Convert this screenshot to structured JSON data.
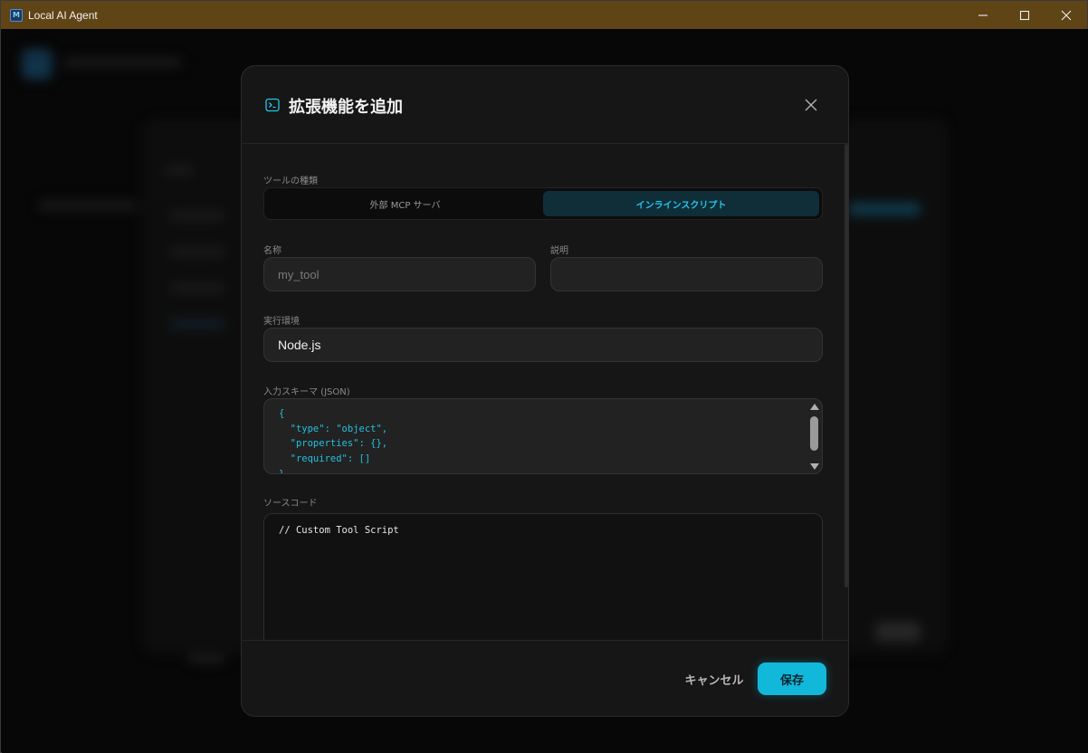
{
  "window": {
    "title": "Local AI Agent",
    "icon_letter": "M",
    "controls": [
      "minimize-icon",
      "maximize-icon",
      "close-icon"
    ]
  },
  "modal": {
    "title": "拡張機能を追加",
    "header_icon": "terminal-icon",
    "tool_type": {
      "label": "ツールの種類",
      "options": [
        "外部 MCP サーバ",
        "インラインスクリプト"
      ],
      "selected": "インラインスクリプト"
    },
    "name": {
      "label": "名称",
      "placeholder": "my_tool"
    },
    "description": {
      "label": "説明",
      "value": ""
    },
    "runtime": {
      "label": "実行環境",
      "value": "Node.js"
    },
    "input_schema": {
      "label": "入力スキーマ (JSON)",
      "code": "{\n  \"type\": \"object\",\n  \"properties\": {},\n  \"required\": []\n}"
    },
    "source_code": {
      "label": "ソースコード",
      "code": "// Custom Tool Script"
    },
    "footer": {
      "cancel_label": "キャンセル",
      "save_label": "保存"
    }
  },
  "colors": {
    "titlebar": "#5f4416",
    "accent": "#12b8da",
    "active_segment_text": "#22c6ea",
    "modal_bg": "#161616"
  }
}
